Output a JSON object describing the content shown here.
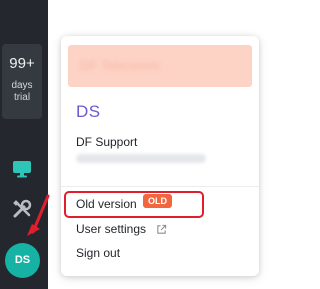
{
  "sidebar": {
    "trial": {
      "count": "99+",
      "line1": "days",
      "line2": "trial"
    },
    "icons": [
      "monitor-icon",
      "tools-icon"
    ],
    "avatar_initials": "DS",
    "avatar_color": "#16b3a4",
    "background": "#24282e"
  },
  "menu": {
    "org_name": "DF Telecomm",
    "user_initials": "DS",
    "user_name": "DF Support",
    "user_email": "support@dfsupport.com",
    "items": [
      {
        "label": "Old version",
        "badge": "OLD"
      },
      {
        "label": "User settings",
        "icon": "external-link-icon"
      },
      {
        "label": "Sign out"
      }
    ]
  },
  "annotation": {
    "highlight_color": "#e01e2d",
    "arrow_color": "#e01e2d"
  }
}
